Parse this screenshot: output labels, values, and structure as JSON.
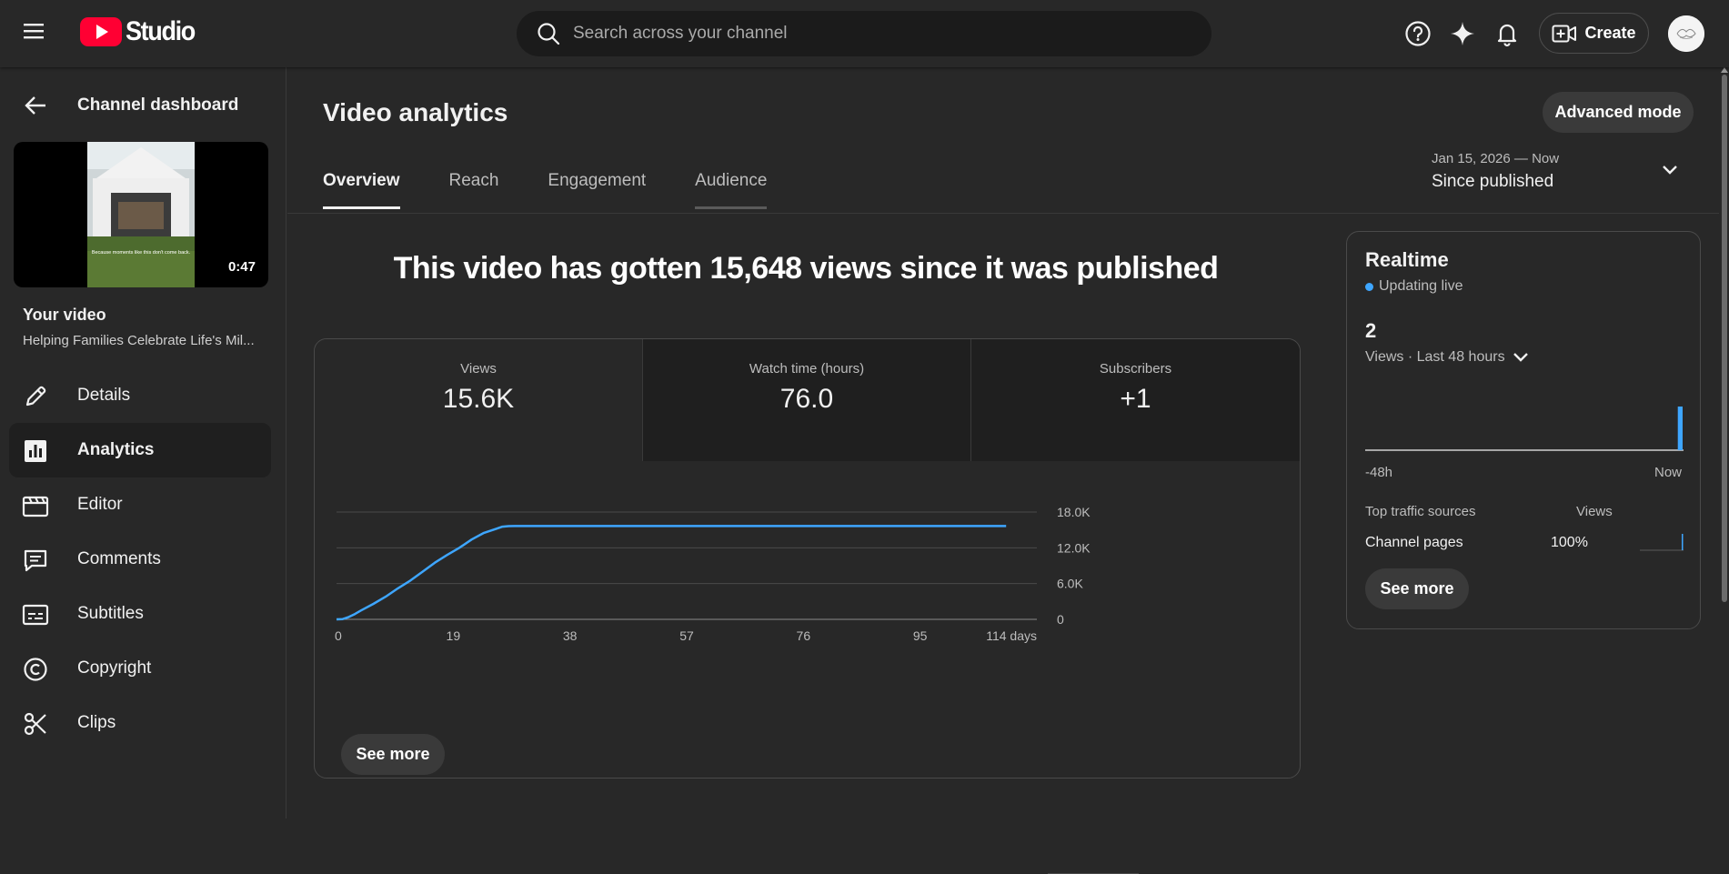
{
  "header": {
    "logo_text": "Studio",
    "search_placeholder": "Search across your channel",
    "create_label": "Create"
  },
  "sidebar": {
    "back_label": "Channel dashboard",
    "thumbnail": {
      "duration": "0:47",
      "caption": "Because moments like this don't come back."
    },
    "video_title": "Your video",
    "video_subtitle": "Helping Families Celebrate Life's Mil...",
    "items": [
      {
        "label": "Details",
        "icon": "pencil-icon"
      },
      {
        "label": "Analytics",
        "icon": "analytics-icon",
        "active": true
      },
      {
        "label": "Editor",
        "icon": "clapperboard-icon"
      },
      {
        "label": "Comments",
        "icon": "comment-icon"
      },
      {
        "label": "Subtitles",
        "icon": "subtitles-icon"
      },
      {
        "label": "Copyright",
        "icon": "copyright-icon"
      },
      {
        "label": "Clips",
        "icon": "scissors-icon"
      }
    ]
  },
  "main": {
    "title": "Video analytics",
    "advanced_mode_label": "Advanced mode",
    "tabs": [
      {
        "label": "Overview",
        "active": true
      },
      {
        "label": "Reach"
      },
      {
        "label": "Engagement"
      },
      {
        "label": "Audience"
      }
    ],
    "date_range": {
      "range": "Jan 15, 2026 — Now",
      "label": "Since published"
    },
    "headline": "This video has gotten 15,648 views since it was published",
    "metrics": [
      {
        "label": "Views",
        "value": "15.6K"
      },
      {
        "label": "Watch time (hours)",
        "value": "76.0"
      },
      {
        "label": "Subscribers",
        "value": "+1"
      }
    ],
    "see_more_label": "See more"
  },
  "chart_data": {
    "type": "line",
    "x_tick_labels": [
      "0",
      "19",
      "38",
      "57",
      "76",
      "95",
      "114 days"
    ],
    "y_tick_labels": [
      "0",
      "6.0K",
      "12.0K",
      "18.0K"
    ],
    "xlim": [
      0,
      114
    ],
    "ylim": [
      0,
      18000
    ],
    "series": [
      {
        "x": [
          0,
          1,
          2,
          3,
          4,
          6,
          8,
          10,
          12,
          14,
          16,
          18,
          20,
          22,
          24,
          26,
          27,
          28,
          29,
          30,
          32,
          40,
          60,
          80,
          100,
          109
        ],
        "y": [
          0,
          50,
          400,
          900,
          1500,
          2600,
          3800,
          5200,
          6500,
          8000,
          9500,
          10800,
          12000,
          13400,
          14500,
          15200,
          15550,
          15640,
          15648,
          15648,
          15648,
          15648,
          15648,
          15648,
          15648,
          15648
        ]
      }
    ],
    "color": "#3ea6ff",
    "grid": true
  },
  "realtime": {
    "title": "Realtime",
    "status": "Updating live",
    "count": "2",
    "period": "Views · Last 48 hours",
    "axis_left": "-48h",
    "axis_right": "Now",
    "bars": [
      0,
      0,
      0,
      0,
      0,
      0,
      0,
      0,
      0,
      0,
      0,
      0,
      0,
      0,
      0,
      0,
      0,
      0,
      0,
      0,
      0,
      0,
      0,
      0,
      0,
      0,
      0,
      0,
      0,
      0,
      0,
      0,
      0,
      0,
      0,
      0,
      0,
      0,
      0,
      0,
      0,
      0,
      0,
      0,
      0,
      0,
      0,
      2
    ],
    "table_header_source": "Top traffic sources",
    "table_header_views": "Views",
    "sources": [
      {
        "name": "Channel pages",
        "percent": "100%",
        "share": 1.0
      }
    ],
    "see_more_label": "See more"
  },
  "colors": {
    "accent": "#3ea6ff",
    "brand_red": "#ff0033"
  }
}
